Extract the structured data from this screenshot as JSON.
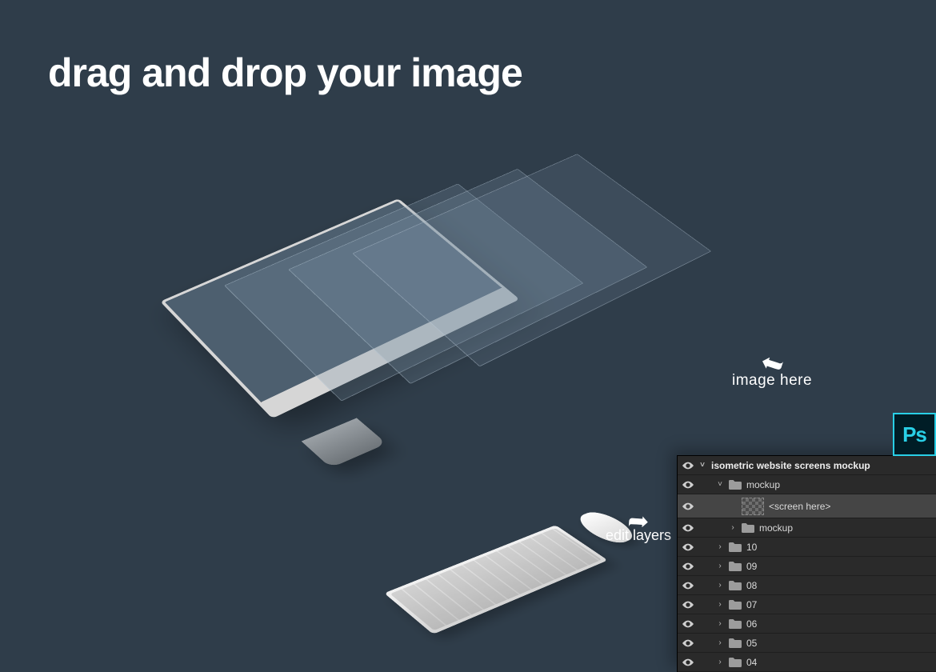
{
  "headline": "drag and drop your image",
  "callouts": {
    "image_here": "image here",
    "edit_layers": "edit layers"
  },
  "ps_icon": {
    "label": "Ps"
  },
  "layers_panel": {
    "header": {
      "name": "isometric website screens mockup",
      "twisty": "˅",
      "indent": 0
    },
    "rows": [
      {
        "type": "folder",
        "name": "mockup",
        "twisty": "˅",
        "indent": 1,
        "open": true
      },
      {
        "type": "smart",
        "name": "<screen here>",
        "twisty": "",
        "indent": 2,
        "selected": true,
        "thumb": true
      },
      {
        "type": "folder",
        "name": "mockup",
        "twisty": "›",
        "indent": 2
      },
      {
        "type": "folder",
        "name": "10",
        "twisty": "›",
        "indent": 1
      },
      {
        "type": "folder",
        "name": "09",
        "twisty": "›",
        "indent": 1
      },
      {
        "type": "folder",
        "name": "08",
        "twisty": "›",
        "indent": 1
      },
      {
        "type": "folder",
        "name": "07",
        "twisty": "›",
        "indent": 1
      },
      {
        "type": "folder",
        "name": "06",
        "twisty": "›",
        "indent": 1
      },
      {
        "type": "folder",
        "name": "05",
        "twisty": "›",
        "indent": 1
      },
      {
        "type": "folder",
        "name": "04",
        "twisty": "›",
        "indent": 1
      }
    ]
  }
}
